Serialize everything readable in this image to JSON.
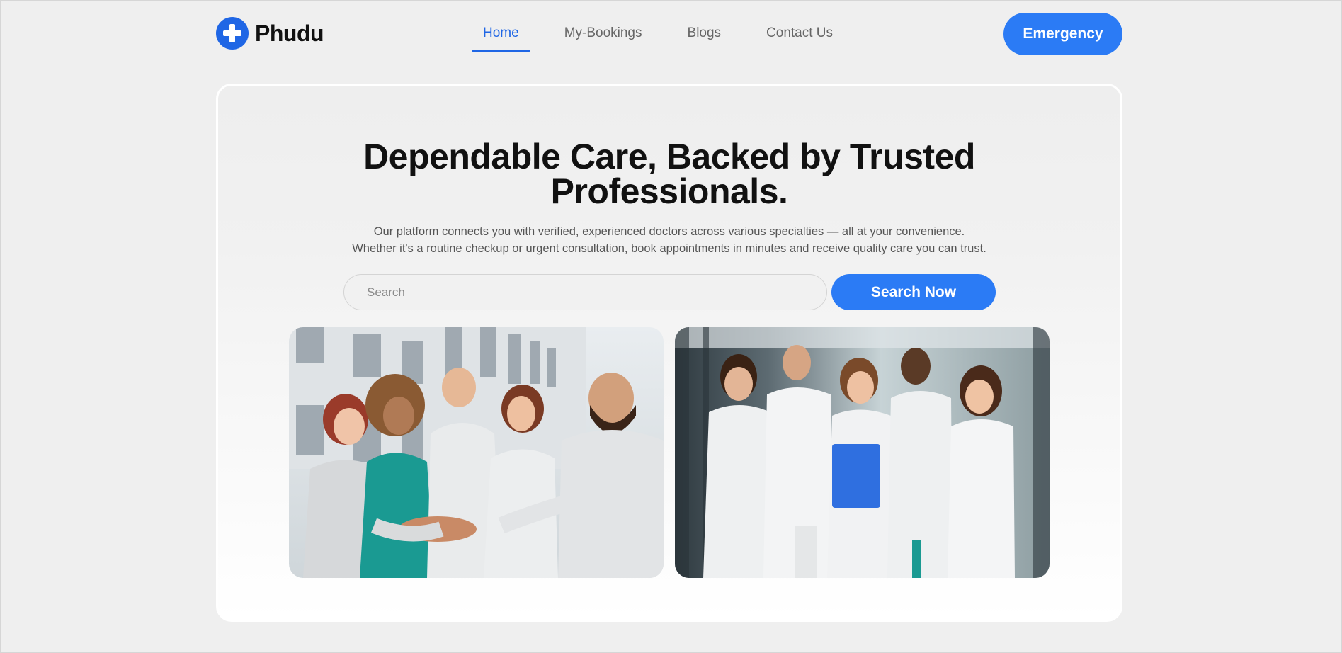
{
  "brand": {
    "name": "Phudu",
    "icon": "medical-cross-icon",
    "color": "#1f66e5"
  },
  "nav": {
    "items": [
      {
        "label": "Home",
        "active": true
      },
      {
        "label": "My-Bookings",
        "active": false
      },
      {
        "label": "Blogs",
        "active": false
      },
      {
        "label": "Contact Us",
        "active": false
      }
    ],
    "emergency_label": "Emergency"
  },
  "hero": {
    "title_line1": "Dependable Care, Backed by Trusted",
    "title_line2": "Professionals.",
    "subtitle_line1": "Our platform connects you with verified, experienced doctors across various specialties — all at your convenience.",
    "subtitle_line2": "Whether it's a routine checkup or urgent consultation, book appointments in minutes and receive quality care you can trust.",
    "search": {
      "placeholder": "Search",
      "value": "",
      "button_label": "Search Now"
    }
  },
  "colors": {
    "accent": "#2b7bf5",
    "brand": "#1f66e5",
    "background": "#efefef"
  }
}
